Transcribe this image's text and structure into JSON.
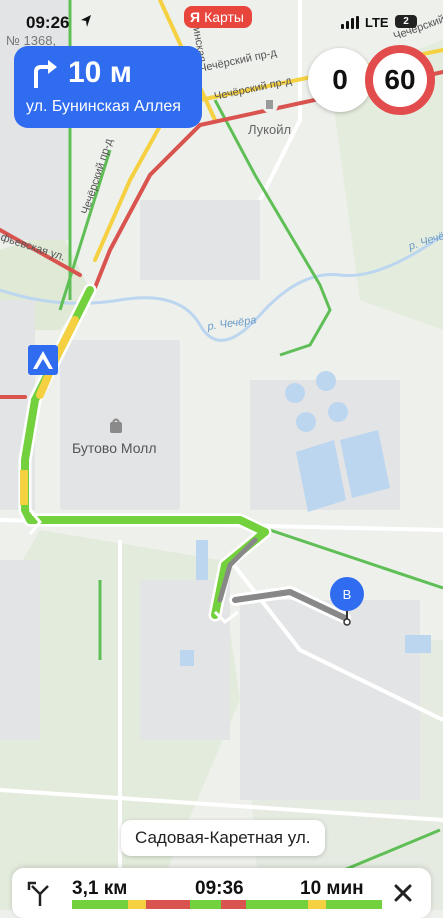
{
  "status_bar": {
    "time": "09:26",
    "carrier_logo": "Я",
    "carrier_name": "Карты",
    "network": "LTE",
    "battery": "2"
  },
  "navigation": {
    "distance": "10 м",
    "street": "ул. Бунинская Аллея",
    "turn_icon": "turn-right-icon"
  },
  "speed": {
    "current": "0",
    "limit": "60"
  },
  "map_labels": {
    "house_number": "№ 1368,",
    "street_bunin": "Бунинская",
    "street_chechersky_pr": "Чечёрский пр-д",
    "street_chechersky_pr2": "Чечёрский пр-д",
    "street_chechersky_vertical": "Чечёрский пр-д",
    "street_chechersky_right": "Чечёрский",
    "street_fevskaya": "фьевская ул.",
    "fuel": "Лукойл",
    "river1": "р. Чечёра",
    "river2": "р. Чечёра",
    "mall": "Бутово Молл",
    "destination_marker": "B"
  },
  "current_street": "Садовая-Каретная ул.",
  "route": {
    "distance": "3,1 км",
    "eta": "09:36",
    "duration": "10 мин"
  },
  "colors": {
    "route_green": "#73d13d",
    "route_yellow": "#f5d142",
    "route_red": "#d9534f",
    "accent_blue": "#2f6cf0",
    "speed_limit_red": "#e34c4c"
  }
}
